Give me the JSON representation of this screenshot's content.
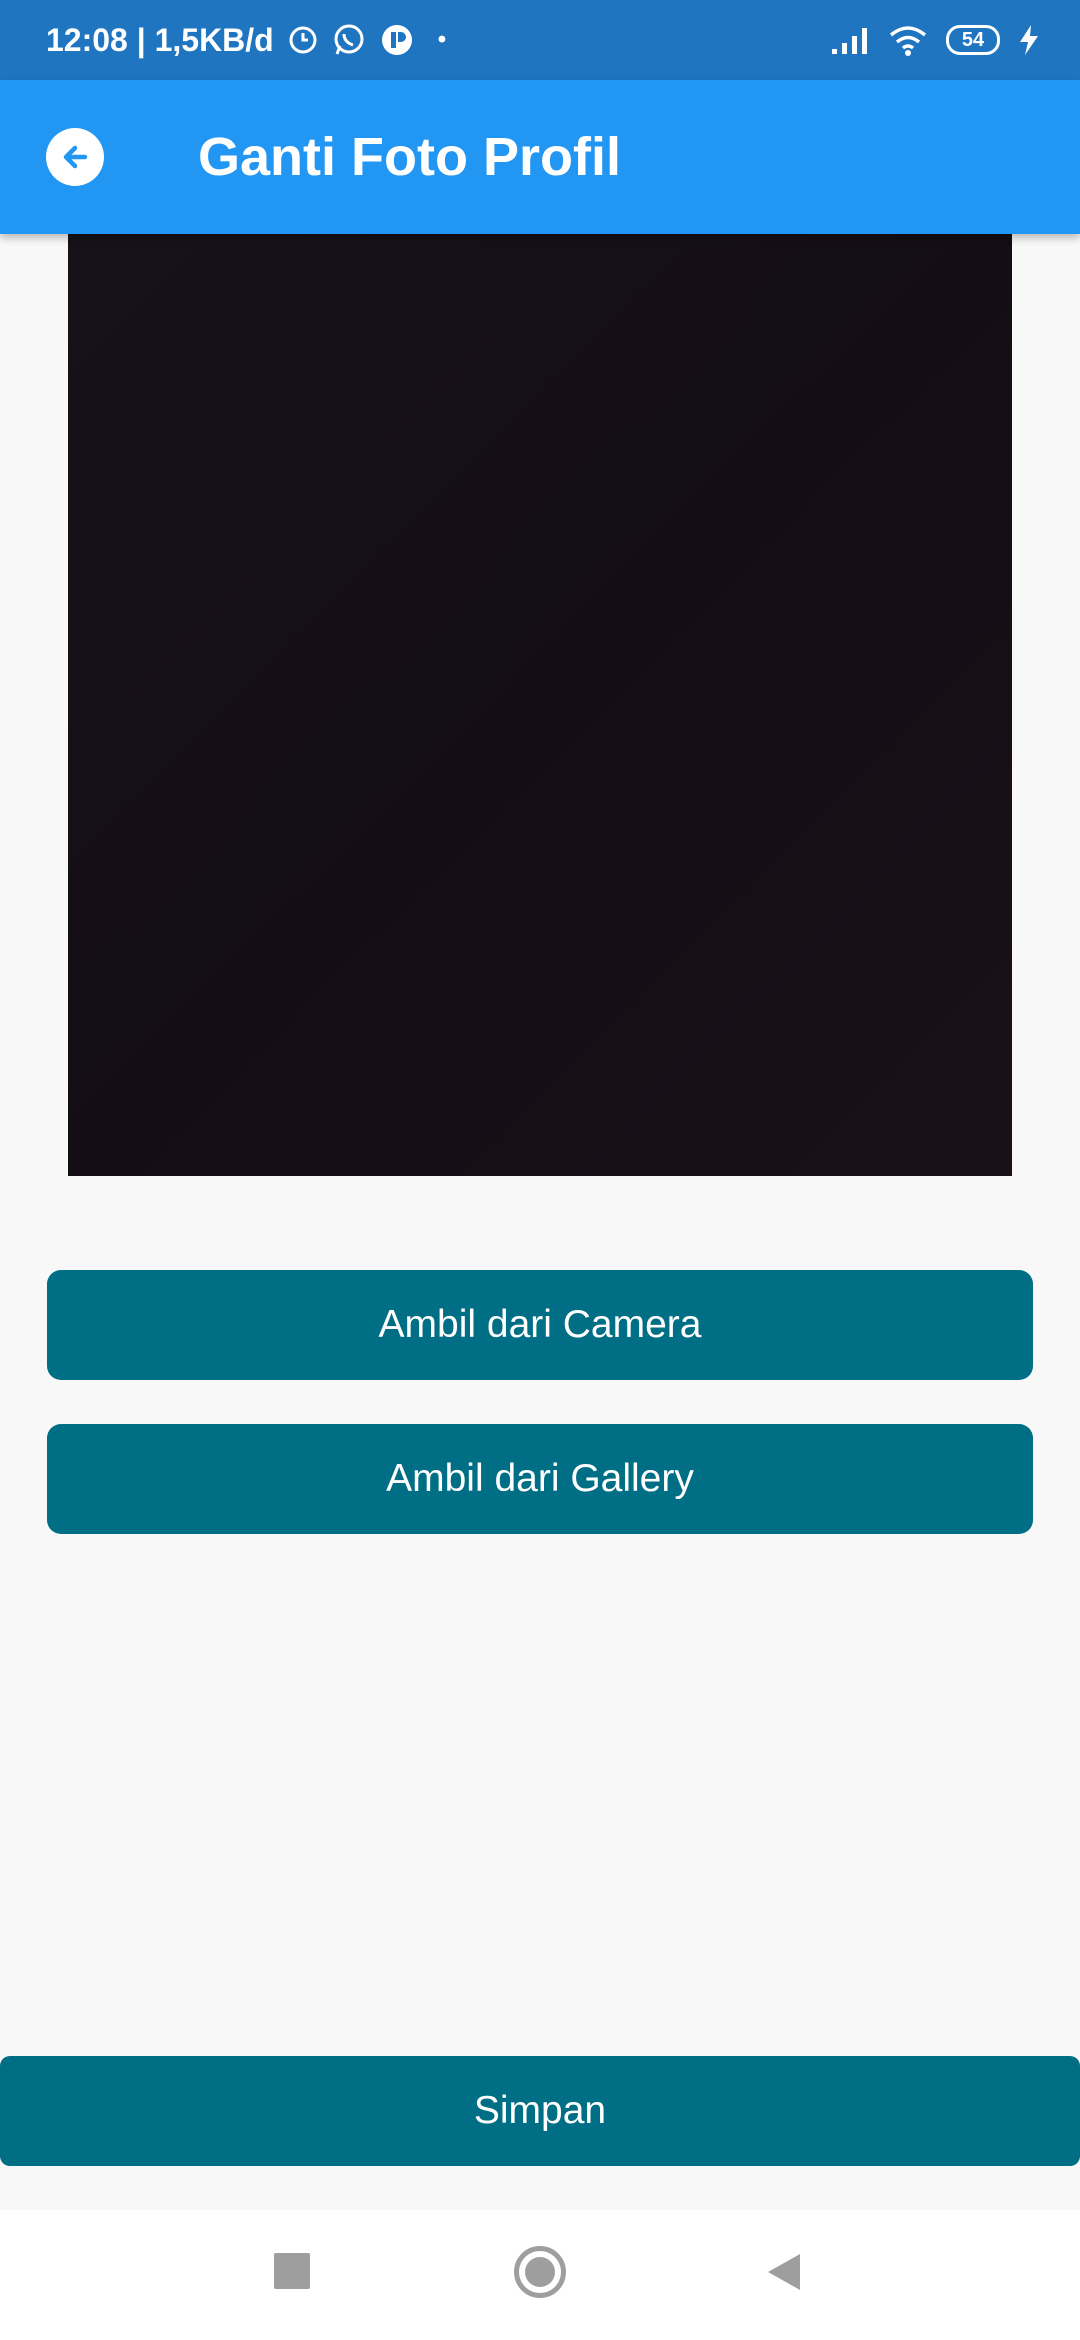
{
  "status_bar": {
    "time_speed": "12:08 | 1,5KB/d",
    "dot": "•",
    "battery_level": "54",
    "icons": [
      "alarm-icon",
      "whatsapp-icon",
      "app-icon",
      "signal-icon",
      "wifi-icon",
      "battery-icon",
      "charging-icon"
    ]
  },
  "app_bar": {
    "title": "Ganti Foto Profil",
    "back_icon": "arrow-left-icon"
  },
  "preview": {
    "image": "profile-photo-preview"
  },
  "actions": {
    "camera_label": "Ambil dari Camera",
    "gallery_label": "Ambil dari Gallery",
    "save_label": "Simpan"
  },
  "nav_bar": {
    "icons": [
      "recents-icon",
      "home-icon",
      "back-icon"
    ]
  },
  "colors": {
    "status_bar": "#1f75c0",
    "app_bar": "#2196f3",
    "button": "#006e85",
    "background": "#f8f8f8"
  }
}
